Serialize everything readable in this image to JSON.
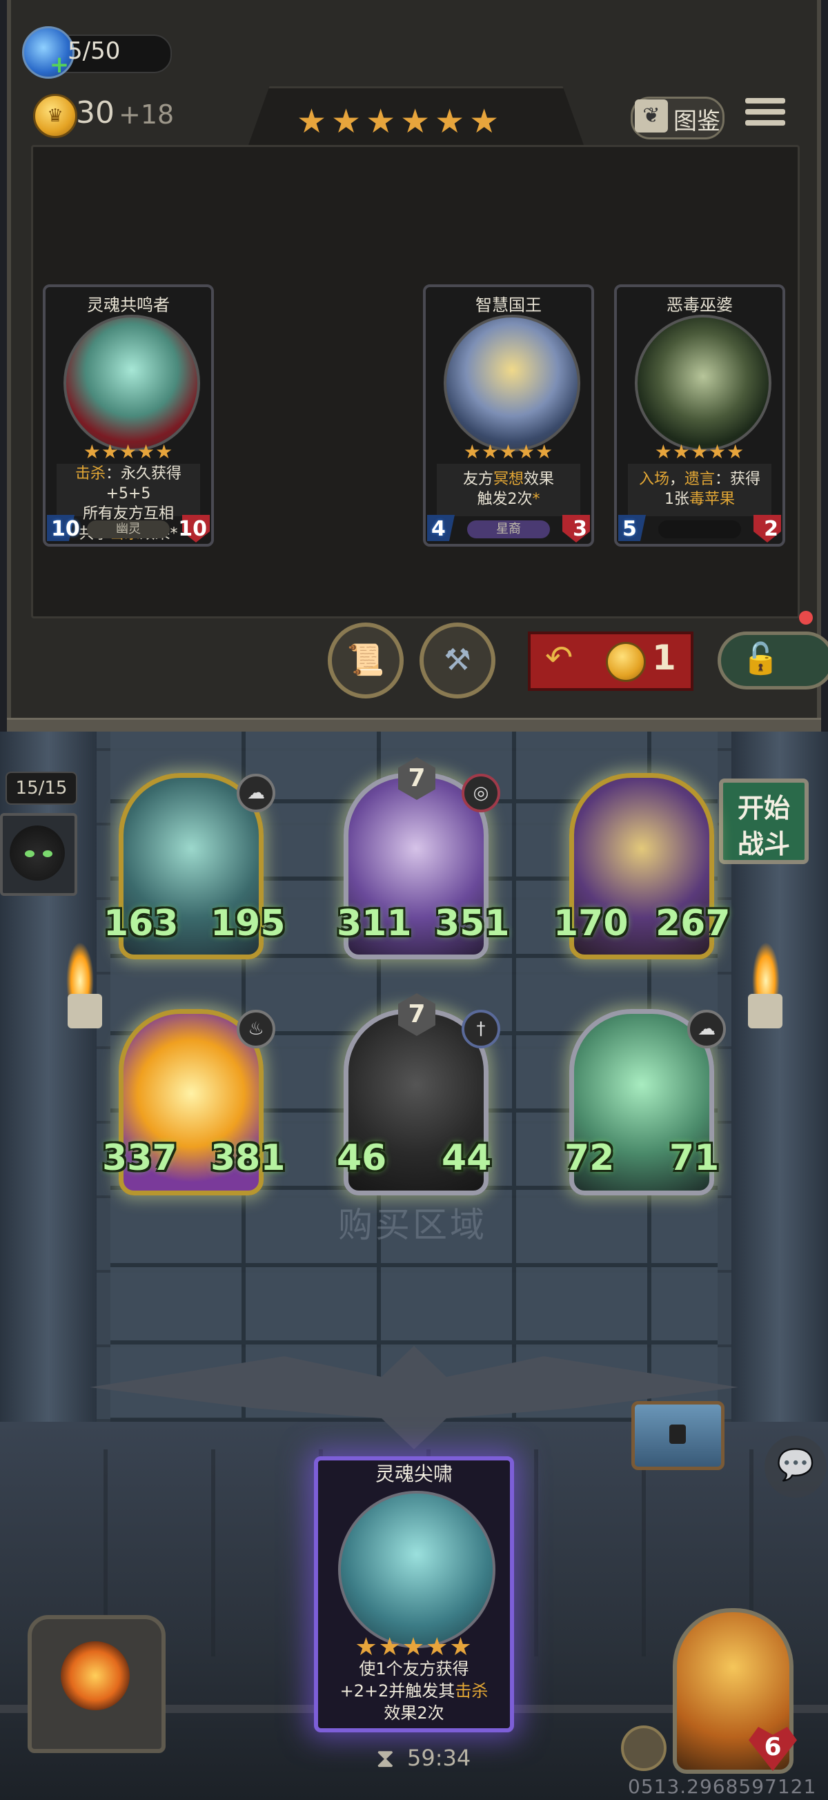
{
  "top_bar": {
    "mana_text": "5/50",
    "gold": "30",
    "gold_income": "+18",
    "tier_stars": "★★★★★★",
    "codex_label": "图鉴"
  },
  "shop_cards": [
    {
      "name": "灵魂共鸣者",
      "stars": "★★★★★",
      "desc_parts": [
        "击杀",
        "：永久获得+5+5",
        "所有友方互相",
        "共享",
        "击杀",
        "效果*"
      ],
      "attack": "10",
      "health": "10",
      "race": "幽灵"
    },
    {
      "name": "智慧国王",
      "stars": "★★★★★",
      "desc_parts": [
        "友方",
        "冥想",
        "效果",
        "触发2次",
        "*"
      ],
      "attack": "4",
      "health": "3",
      "race": "星裔"
    },
    {
      "name": "恶毒巫婆",
      "stars": "★★★★★",
      "desc_parts": [
        "入场",
        "，",
        "遗言",
        "：获得",
        "1张",
        "毒苹果"
      ],
      "attack": "5",
      "health": "2",
      "race": ""
    }
  ],
  "shop_controls": {
    "refresh_cost": "1"
  },
  "board": {
    "team_count": "15/15",
    "start_battle_line1": "开始",
    "start_battle_line2": "战斗",
    "buy_zone_label": "购买区域",
    "minions": [
      {
        "atk": "163",
        "hp": "195",
        "tribe": "ghost",
        "tier": ""
      },
      {
        "atk": "311",
        "hp": "351",
        "tribe": "spiral",
        "tier": "7"
      },
      {
        "atk": "170",
        "hp": "267",
        "tribe": "",
        "tier": ""
      },
      {
        "atk": "337",
        "hp": "381",
        "tribe": "flame",
        "tier": ""
      },
      {
        "atk": "46",
        "hp": "44",
        "tribe": "sword",
        "tier": "7"
      },
      {
        "atk": "72",
        "hp": "71",
        "tribe": "ghost",
        "tier": ""
      }
    ]
  },
  "hand_card": {
    "name": "灵魂尖啸",
    "stars": "★★★★★",
    "desc_line1": "使1个友方获得",
    "desc_line2a": "+2+2并触发其",
    "desc_line2b": "击杀",
    "desc_line3": "效果2次"
  },
  "footer": {
    "timer": "59:34",
    "hero_health": "6",
    "watermark": "0513.2968597121"
  },
  "colors": {
    "gold": "#e7a53c",
    "highlight": "#e4a835",
    "stat_green": "#b6f3a0",
    "refresh_red": "#9e1f1f",
    "hand_glow": "#7d5fd8"
  }
}
